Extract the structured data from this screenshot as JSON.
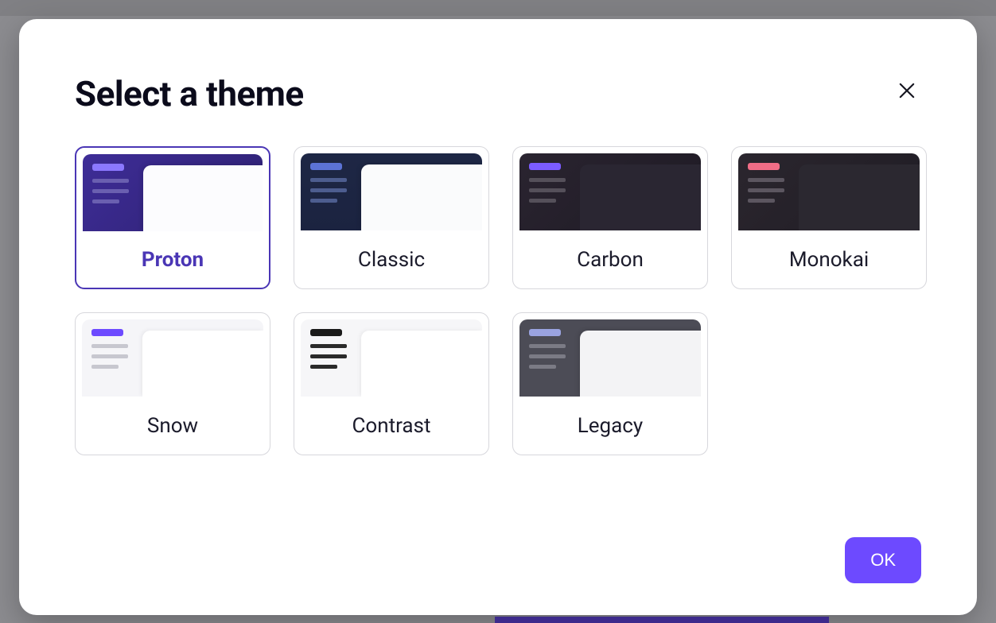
{
  "modal": {
    "title": "Select a theme",
    "ok_label": "OK"
  },
  "themes": [
    {
      "id": "proton",
      "label": "Proton",
      "preview_class": "pv-proton",
      "selected": true
    },
    {
      "id": "classic",
      "label": "Classic",
      "preview_class": "pv-classic",
      "selected": false
    },
    {
      "id": "carbon",
      "label": "Carbon",
      "preview_class": "pv-carbon",
      "selected": false
    },
    {
      "id": "monokai",
      "label": "Monokai",
      "preview_class": "pv-monokai",
      "selected": false
    },
    {
      "id": "snow",
      "label": "Snow",
      "preview_class": "pv-snow",
      "selected": false
    },
    {
      "id": "contrast",
      "label": "Contrast",
      "preview_class": "pv-contrast",
      "selected": false
    },
    {
      "id": "legacy",
      "label": "Legacy",
      "preview_class": "pv-legacy",
      "selected": false
    }
  ]
}
